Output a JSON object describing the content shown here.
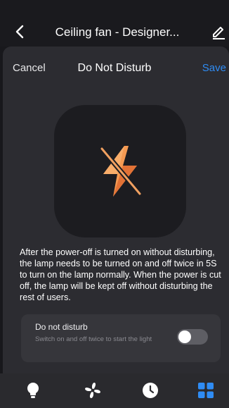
{
  "header": {
    "title": "Ceiling fan - Designer...",
    "back_icon": "chevron-left-icon",
    "edit_icon": "pencil-icon"
  },
  "sheet": {
    "cancel_label": "Cancel",
    "title": "Do Not Disturb",
    "save_label": "Save",
    "hero_icon": "bolt-slash-icon",
    "description": "After the power-off is turned on without disturbing, the lamp needs to be turned on and off twice in 5S to turn on the lamp normally. When the power is cut off, the lamp will be kept off without disturbing the rest of users."
  },
  "setting": {
    "label": "Do not disturb",
    "sublabel": "Switch on and off twice to start the light",
    "toggle_on": false
  },
  "bottom_nav": [
    {
      "icon": "light-bulb-icon",
      "active": false
    },
    {
      "icon": "fan-icon",
      "active": false
    },
    {
      "icon": "clock-icon",
      "active": false
    },
    {
      "icon": "grid-icon",
      "active": true
    }
  ],
  "colors": {
    "accent": "#2f8cf4",
    "bolt_light": "#f9a45a",
    "bolt_dark": "#e8763a",
    "background": "#18181c",
    "sheet": "#2c2c31"
  }
}
